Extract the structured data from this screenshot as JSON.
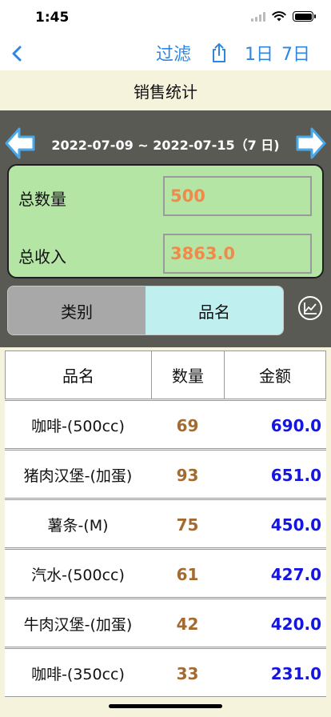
{
  "status": {
    "time": "1:45"
  },
  "nav": {
    "filter_label": "过滤",
    "day_label": "1日",
    "week_label": "7日"
  },
  "page": {
    "title": "销售统计"
  },
  "summary": {
    "date_range": "2022-07-09 ~ 2022-07-15（7 日)",
    "total_qty_label": "总数量",
    "total_qty_value": "500",
    "total_income_label": "总收入",
    "total_income_value": "3863.0"
  },
  "tabs": {
    "category_label": "类别",
    "item_label": "品名",
    "active": "品名"
  },
  "table": {
    "headers": {
      "name": "品名",
      "qty": "数量",
      "amount": "金额"
    },
    "rows": [
      {
        "name": "咖啡-(500cc)",
        "qty": "69",
        "amount": "690.0"
      },
      {
        "name": "猪肉汉堡-(加蛋)",
        "qty": "93",
        "amount": "651.0"
      },
      {
        "name": "薯条-(M)",
        "qty": "75",
        "amount": "450.0"
      },
      {
        "name": "汽水-(500cc)",
        "qty": "61",
        "amount": "427.0"
      },
      {
        "name": "牛肉汉堡-(加蛋)",
        "qty": "42",
        "amount": "420.0"
      },
      {
        "name": "咖啡-(350cc)",
        "qty": "33",
        "amount": "231.0"
      }
    ]
  },
  "colors": {
    "accent_blue": "#2f86e0",
    "panel_gray": "#5a5a55",
    "totals_green": "#b4e5a5",
    "value_orange": "#f08a4b",
    "qty_brown": "#a36b32",
    "amount_blue": "#1515e0",
    "active_tab": "#bff0ef",
    "header_cream": "#f6f3dc"
  }
}
